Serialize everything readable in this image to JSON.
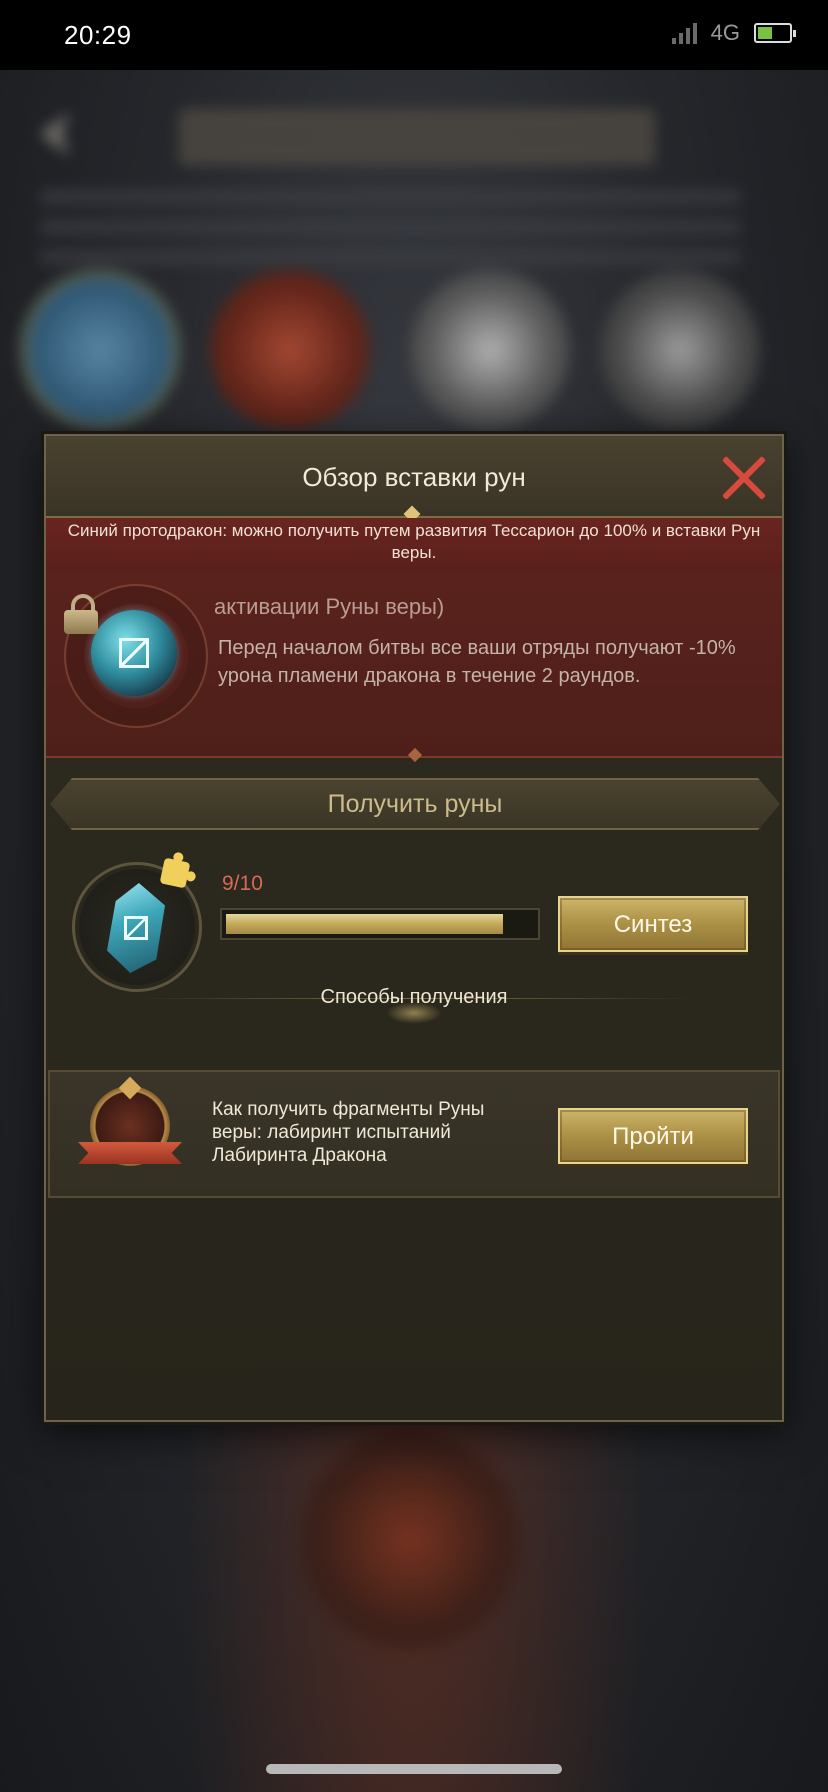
{
  "status_bar": {
    "time": "20:29",
    "network": "4G"
  },
  "dialog": {
    "title": "Обзор вставки рун",
    "notice": "Синий протодракон: можно получить путем развития Тессарион до 100% и вставки Рун веры.",
    "effect": {
      "title": "активации Руны веры)",
      "description": "Перед началом битвы все ваши отряды получают -10% урона пламени дракона в течение 2 раундов.",
      "locked": true
    },
    "get_runes": {
      "section_title": "Получить руны",
      "progress_text": "9/10",
      "progress_fraction": 0.9,
      "synth_button": "Синтез",
      "ways_label": "Способы получения"
    },
    "source": {
      "text": "Как получить фрагменты Руны веры: лабиринт испытаний Лабиринта Дракона",
      "go_button": "Пройти"
    }
  },
  "colors": {
    "close_x": "#d84b3c",
    "progress_text": "#d66a55",
    "gold_button": "#ae9348",
    "notice_band": "#6a2420"
  }
}
